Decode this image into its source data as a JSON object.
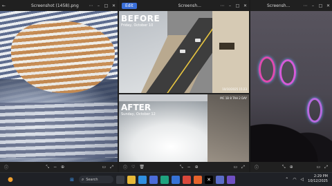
{
  "windows": {
    "left": {
      "title": "Screenshot (1458).png"
    },
    "middle": {
      "edit_label": "Edit",
      "title": "Screensh...",
      "before": {
        "label": "BEFORE",
        "date": "Friday, October 10",
        "stamp": "10/10/2025 15:23"
      },
      "after": {
        "label": "AFTER",
        "date": "Sunday, October 12",
        "stamp": "10/12/2025 13:15"
      },
      "cam_note": "MC 1B 8 TAH 2 DAY"
    },
    "right": {
      "title": "Screensh..."
    }
  },
  "taskbar": {
    "search_placeholder": "Search",
    "time": "2:29 PM",
    "date": "10/12/2025"
  },
  "colors": {
    "taskbar": "#1f2126",
    "accent": "#3a6fd8"
  }
}
